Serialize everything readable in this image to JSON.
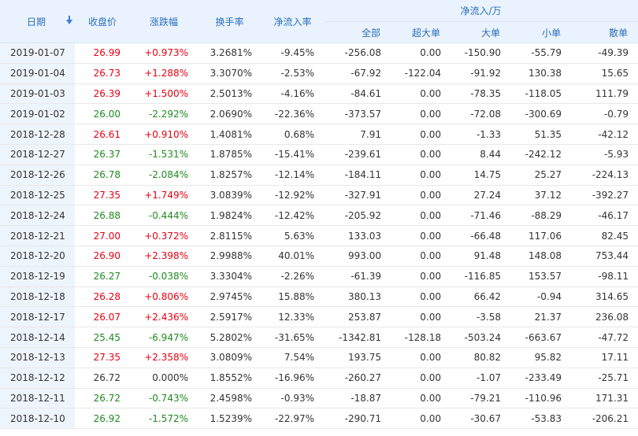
{
  "headers": {
    "date": "日期",
    "close": "收盘价",
    "change": "涨跌幅",
    "turnover": "换手率",
    "netflow_rate": "净流入率",
    "netflow_group": "净流入/万",
    "sub": [
      "全部",
      "超大单",
      "大单",
      "小单",
      "散单"
    ]
  },
  "icons": {
    "sort": "sort-down-icon"
  },
  "colors": {
    "up": "#e60012",
    "down": "#1e8a1e",
    "header_text": "#2a6ebb"
  },
  "rows": [
    {
      "date": "2019-01-07",
      "close": "26.99",
      "change": "+0.973%",
      "turnover": "3.2681%",
      "rate": "-9.45%",
      "all": "-256.08",
      "xl": "0.00",
      "l": "-150.90",
      "s": "-55.79",
      "r": "-49.39",
      "dir": "up"
    },
    {
      "date": "2019-01-04",
      "close": "26.73",
      "change": "+1.288%",
      "turnover": "3.3070%",
      "rate": "-2.53%",
      "all": "-67.92",
      "xl": "-122.04",
      "l": "-91.92",
      "s": "130.38",
      "r": "15.65",
      "dir": "up"
    },
    {
      "date": "2019-01-03",
      "close": "26.39",
      "change": "+1.500%",
      "turnover": "2.5013%",
      "rate": "-4.16%",
      "all": "-84.61",
      "xl": "0.00",
      "l": "-78.35",
      "s": "-118.05",
      "r": "111.79",
      "dir": "up"
    },
    {
      "date": "2019-01-02",
      "close": "26.00",
      "change": "-2.292%",
      "turnover": "2.0690%",
      "rate": "-22.36%",
      "all": "-373.57",
      "xl": "0.00",
      "l": "-72.08",
      "s": "-300.69",
      "r": "-0.79",
      "dir": "down"
    },
    {
      "date": "2018-12-28",
      "close": "26.61",
      "change": "+0.910%",
      "turnover": "1.4081%",
      "rate": "0.68%",
      "all": "7.91",
      "xl": "0.00",
      "l": "-1.33",
      "s": "51.35",
      "r": "-42.12",
      "dir": "up"
    },
    {
      "date": "2018-12-27",
      "close": "26.37",
      "change": "-1.531%",
      "turnover": "1.8785%",
      "rate": "-15.41%",
      "all": "-239.61",
      "xl": "0.00",
      "l": "8.44",
      "s": "-242.12",
      "r": "-5.93",
      "dir": "down"
    },
    {
      "date": "2018-12-26",
      "close": "26.78",
      "change": "-2.084%",
      "turnover": "1.8257%",
      "rate": "-12.14%",
      "all": "-184.11",
      "xl": "0.00",
      "l": "14.75",
      "s": "25.27",
      "r": "-224.13",
      "dir": "down"
    },
    {
      "date": "2018-12-25",
      "close": "27.35",
      "change": "+1.749%",
      "turnover": "3.0839%",
      "rate": "-12.92%",
      "all": "-327.91",
      "xl": "0.00",
      "l": "27.24",
      "s": "37.12",
      "r": "-392.27",
      "dir": "up"
    },
    {
      "date": "2018-12-24",
      "close": "26.88",
      "change": "-0.444%",
      "turnover": "1.9824%",
      "rate": "-12.42%",
      "all": "-205.92",
      "xl": "0.00",
      "l": "-71.46",
      "s": "-88.29",
      "r": "-46.17",
      "dir": "down"
    },
    {
      "date": "2018-12-21",
      "close": "27.00",
      "change": "+0.372%",
      "turnover": "2.8115%",
      "rate": "5.63%",
      "all": "133.03",
      "xl": "0.00",
      "l": "-66.48",
      "s": "117.06",
      "r": "82.45",
      "dir": "up"
    },
    {
      "date": "2018-12-20",
      "close": "26.90",
      "change": "+2.398%",
      "turnover": "2.9988%",
      "rate": "40.01%",
      "all": "993.00",
      "xl": "0.00",
      "l": "91.48",
      "s": "148.08",
      "r": "753.44",
      "dir": "up"
    },
    {
      "date": "2018-12-19",
      "close": "26.27",
      "change": "-0.038%",
      "turnover": "3.3304%",
      "rate": "-2.26%",
      "all": "-61.39",
      "xl": "0.00",
      "l": "-116.85",
      "s": "153.57",
      "r": "-98.11",
      "dir": "down"
    },
    {
      "date": "2018-12-18",
      "close": "26.28",
      "change": "+0.806%",
      "turnover": "2.9745%",
      "rate": "15.88%",
      "all": "380.13",
      "xl": "0.00",
      "l": "66.42",
      "s": "-0.94",
      "r": "314.65",
      "dir": "up"
    },
    {
      "date": "2018-12-17",
      "close": "26.07",
      "change": "+2.436%",
      "turnover": "2.5917%",
      "rate": "12.33%",
      "all": "253.87",
      "xl": "0.00",
      "l": "-3.58",
      "s": "21.37",
      "r": "236.08",
      "dir": "up"
    },
    {
      "date": "2018-12-14",
      "close": "25.45",
      "change": "-6.947%",
      "turnover": "5.2802%",
      "rate": "-31.65%",
      "all": "-1342.81",
      "xl": "-128.18",
      "l": "-503.24",
      "s": "-663.67",
      "r": "-47.72",
      "dir": "down"
    },
    {
      "date": "2018-12-13",
      "close": "27.35",
      "change": "+2.358%",
      "turnover": "3.0809%",
      "rate": "7.54%",
      "all": "193.75",
      "xl": "0.00",
      "l": "80.82",
      "s": "95.82",
      "r": "17.11",
      "dir": "up"
    },
    {
      "date": "2018-12-12",
      "close": "26.72",
      "change": "0.000%",
      "turnover": "1.8552%",
      "rate": "-16.96%",
      "all": "-260.27",
      "xl": "0.00",
      "l": "-1.07",
      "s": "-233.49",
      "r": "-25.71",
      "dir": "flat"
    },
    {
      "date": "2018-12-11",
      "close": "26.72",
      "change": "-0.743%",
      "turnover": "2.4598%",
      "rate": "-0.93%",
      "all": "-18.87",
      "xl": "0.00",
      "l": "-79.21",
      "s": "-110.96",
      "r": "171.31",
      "dir": "down"
    },
    {
      "date": "2018-12-10",
      "close": "26.92",
      "change": "-1.572%",
      "turnover": "1.5239%",
      "rate": "-22.97%",
      "all": "-290.71",
      "xl": "0.00",
      "l": "-30.67",
      "s": "-53.83",
      "r": "-206.21",
      "dir": "down"
    }
  ]
}
